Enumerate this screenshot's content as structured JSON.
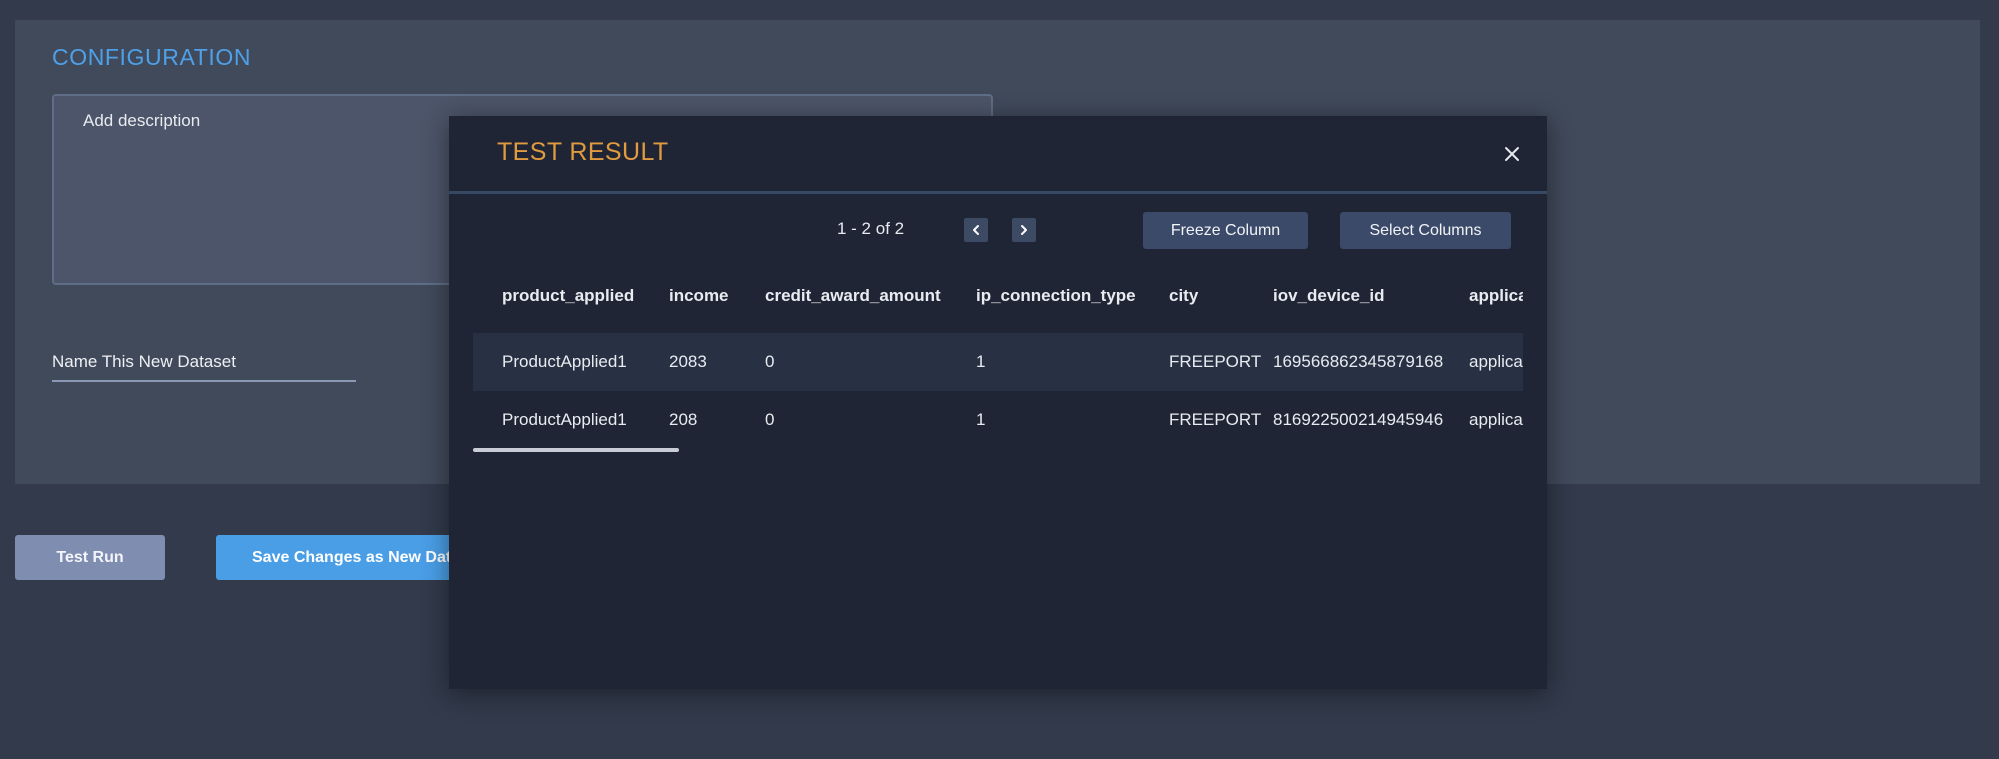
{
  "configuration": {
    "title": "CONFIGURATION",
    "description_placeholder": "Add description",
    "dataset_name_placeholder": "Name This New Dataset"
  },
  "actions": {
    "test_run_label": "Test Run",
    "save_label": "Save Changes as New Dataset"
  },
  "modal": {
    "title": "TEST RESULT",
    "pagination_text": "1 - 2 of 2",
    "freeze_column_label": "Freeze Column",
    "select_columns_label": "Select Columns",
    "table": {
      "columns": [
        "product_applied",
        "income",
        "credit_award_amount",
        "ip_connection_type",
        "city",
        "iov_device_id",
        "application"
      ],
      "rows": [
        [
          "ProductApplied1",
          "2083",
          "0",
          "1",
          "FREEPORT",
          "169566862345879168",
          "application"
        ],
        [
          "ProductApplied1",
          "208",
          "0",
          "1",
          "FREEPORT",
          "816922500214945946",
          "application"
        ]
      ]
    }
  },
  "colors": {
    "background": "#323a4b",
    "panel": "#414a5b",
    "accent_blue": "#4a9ee6",
    "modal_title": "#e09a3f",
    "modal_background": "#1f2534"
  },
  "icons": {
    "close": "close-icon",
    "prev": "chevron-left-icon",
    "next": "chevron-right-icon"
  }
}
